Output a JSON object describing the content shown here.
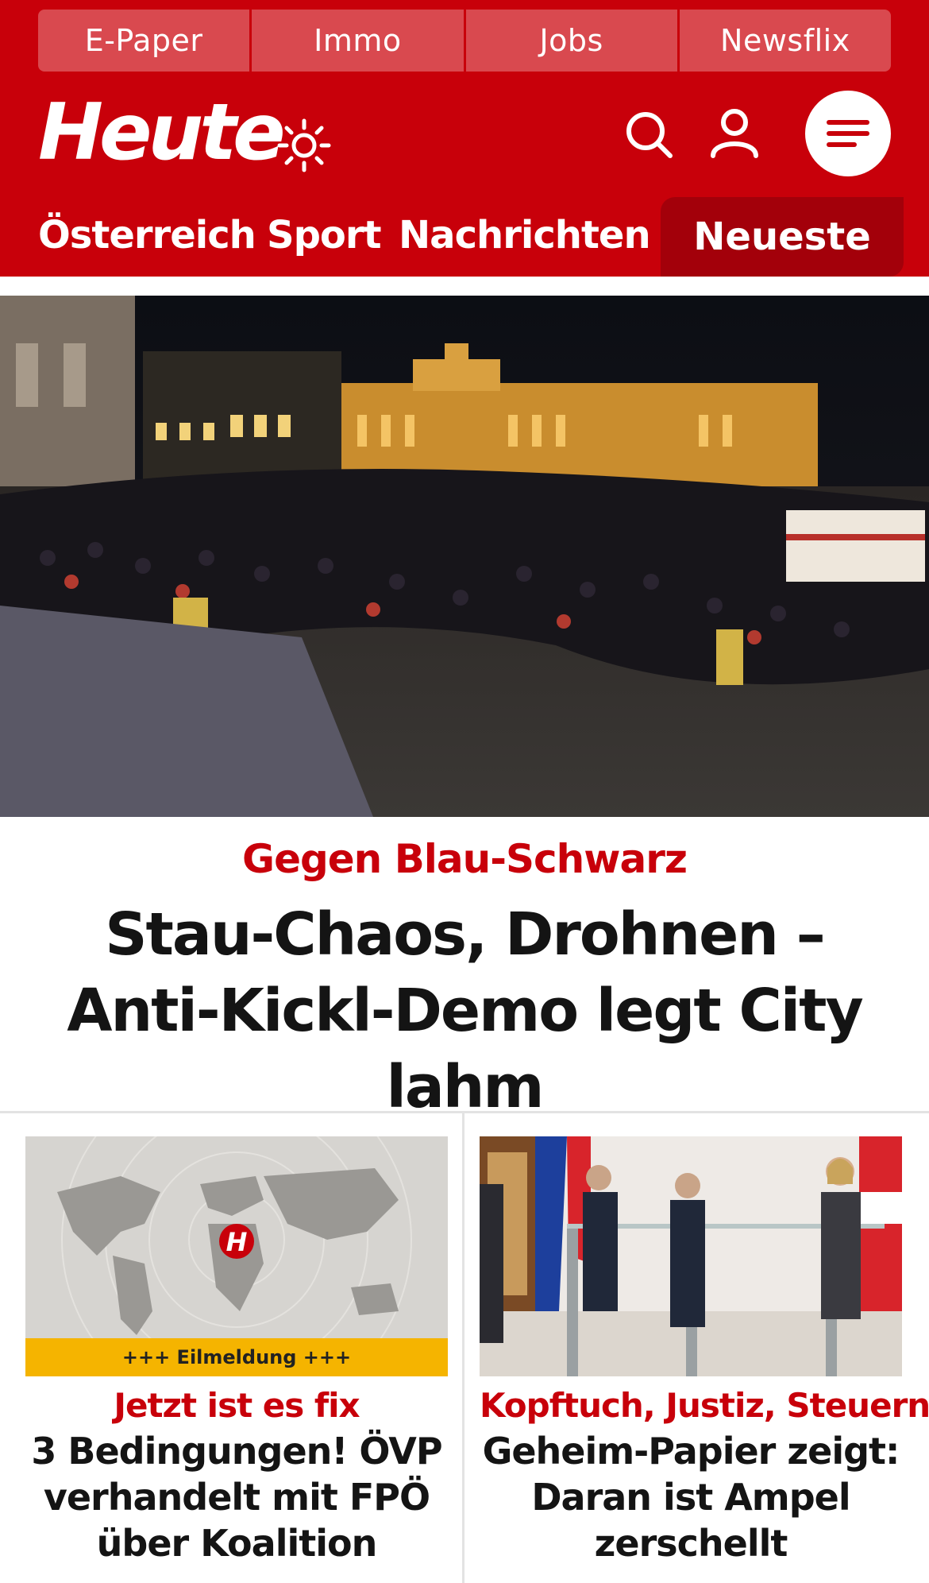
{
  "colors": {
    "brand_red": "#c8000a",
    "dark_red_tab": "#a3000a",
    "kicker_red": "#c8000a",
    "eilmeldung_yellow": "#f5b400"
  },
  "topbar": {
    "items": [
      {
        "label": "E-Paper"
      },
      {
        "label": "Immo"
      },
      {
        "label": "Jobs"
      },
      {
        "label": "Newsflix"
      }
    ]
  },
  "header": {
    "logo": "Heute",
    "icons": {
      "theme": "sun-icon",
      "search": "search-icon",
      "account": "user-icon",
      "menu": "hamburger-menu-icon"
    }
  },
  "nav": {
    "items": [
      {
        "label": "Österreich"
      },
      {
        "label": "Sport"
      },
      {
        "label": "Nachrichten"
      }
    ],
    "active": "Neueste"
  },
  "hero": {
    "image": "night-protest-crowd-photo",
    "kicker": "Gegen Blau-Schwarz",
    "title": "Stau-Chaos, Drohnen – Anti-Kickl-Demo legt City lahm"
  },
  "cards": [
    {
      "image": "world-map-breaking-news-graphic",
      "image_badge": "+++ Eilmeldung +++",
      "kicker": "Jetzt ist es fix",
      "title": "3 Bedingungen! ÖVP verhandelt mit FPÖ über Koalition"
    },
    {
      "image": "press-conference-photo",
      "kicker": "Kopftuch, Justiz, Steuern",
      "title": "Geheim-Papier zeigt: Daran ist Ampel zerschellt"
    }
  ]
}
